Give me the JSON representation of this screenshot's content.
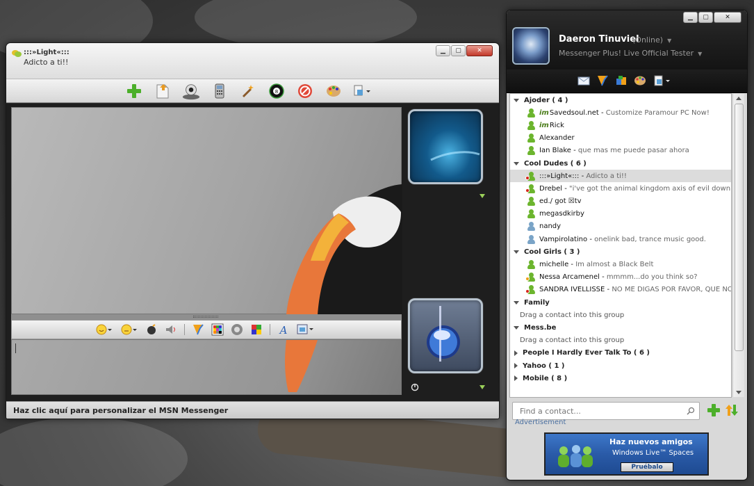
{
  "chat": {
    "contact_name": ":::»Light«:::",
    "contact_pmsg": "Adicto a ti!!",
    "window_buttons": {
      "minimize": "▁",
      "maximize": "▢",
      "close": "✕"
    },
    "toolbar_icons": [
      "add-contact-icon",
      "send-file-icon",
      "webcam-icon",
      "phone-icon",
      "activities-wand-icon",
      "games-8ball-icon",
      "block-icon",
      "palette-icon",
      "menu-icon"
    ],
    "input_toolbar_icons": [
      "emoticon-icon",
      "wink-icon",
      "nudge-icon",
      "voice-clip-icon",
      "messenger-plus-icon",
      "color-grid-icon",
      "sounds-icon",
      "ink-icon",
      "font-icon",
      "background-icon"
    ],
    "status_text": "Haz clic aquí para personalizar el MSN Messenger"
  },
  "contact_list": {
    "window_buttons": {
      "minimize": "▁",
      "maximize": "▢",
      "close": "✕"
    },
    "me": {
      "name": "Daeron Tinuviel",
      "status": "(Online)",
      "personal_message": "Messenger Plus! Live Official Tester"
    },
    "tool_icons": [
      "mail-icon",
      "messenger-plus-icon",
      "shop-icon",
      "palette-icon",
      "menu-icon"
    ],
    "rows": [
      {
        "type": "group",
        "label": "Ajoder ( 4 )",
        "expanded": true
      },
      {
        "type": "contact",
        "status": "online",
        "im": true,
        "name": "Savedsoul.net",
        "sep": " - ",
        "msg": "Customize Paramour PC Now!"
      },
      {
        "type": "contact",
        "status": "online",
        "im": true,
        "name": "Rick",
        "sep": "",
        "msg": ""
      },
      {
        "type": "contact",
        "status": "online",
        "im": false,
        "name": "Alexander",
        "sep": "",
        "msg": ""
      },
      {
        "type": "contact",
        "status": "online",
        "im": false,
        "name": "Ian Blake",
        "sep": " - ",
        "msg": "que mas me puede pasar ahora"
      },
      {
        "type": "group",
        "label": "Cool Dudes ( 6 )",
        "expanded": true
      },
      {
        "type": "contact",
        "status": "busy",
        "im": false,
        "selected": true,
        "name": ":::»Light«:::",
        "sep": " - ",
        "msg": "Adicto a ti!!"
      },
      {
        "type": "contact",
        "status": "busy",
        "im": false,
        "name": "Drebel",
        "sep": " - ",
        "msg": "\"i've got the animal kingdom axis of evil down th..."
      },
      {
        "type": "contact",
        "status": "online",
        "im": false,
        "name": "ed./ got ☒tv",
        "sep": "",
        "msg": ""
      },
      {
        "type": "contact",
        "status": "online",
        "im": false,
        "name": "megasdkirby",
        "sep": "",
        "msg": ""
      },
      {
        "type": "contact",
        "status": "off",
        "im": false,
        "name": "nandy",
        "sep": "",
        "msg": ""
      },
      {
        "type": "contact",
        "status": "off",
        "im": false,
        "name": "Vampirolatino",
        "sep": " - ",
        "msg": "onelink bad, trance music good."
      },
      {
        "type": "group",
        "label": "Cool Girls ( 3 )",
        "expanded": true
      },
      {
        "type": "contact",
        "status": "online",
        "im": false,
        "name": "michelle",
        "sep": " - ",
        "msg": "Im almost a Black Belt"
      },
      {
        "type": "contact",
        "status": "away",
        "im": false,
        "name": "Nessa Arcamenel",
        "sep": " - ",
        "msg": "mmmm...do you think so?"
      },
      {
        "type": "contact",
        "status": "busy",
        "im": false,
        "name": "SANDRA IVELLISSE",
        "sep": " - ",
        "msg": "NO ME DIGAS POR FAVOR, QUE NO VUEL..."
      },
      {
        "type": "group",
        "label": "Family",
        "expanded": true
      },
      {
        "type": "empty",
        "label": "Drag a contact into this group"
      },
      {
        "type": "group",
        "label": "Mess.be",
        "expanded": true
      },
      {
        "type": "empty",
        "label": "Drag a contact into this group"
      },
      {
        "type": "group",
        "label": "People I Hardly Ever Talk To ( 6 )",
        "expanded": false
      },
      {
        "type": "group",
        "label": "Yahoo ( 1 )",
        "expanded": false
      },
      {
        "type": "group",
        "label": "Mobile ( 8 )",
        "expanded": false
      }
    ],
    "search_placeholder": "Find a contact...",
    "ad": {
      "label": "Advertisement",
      "line1": "Haz nuevos amigos",
      "line2": "Windows Live™ Spaces",
      "button": "Pruébalo"
    }
  },
  "colors": {
    "online": "#6cb52e",
    "busy": "#d6261c",
    "away": "#f0a01a",
    "offline": "#7aa4c7",
    "ad_link": "#4a6fa0"
  }
}
